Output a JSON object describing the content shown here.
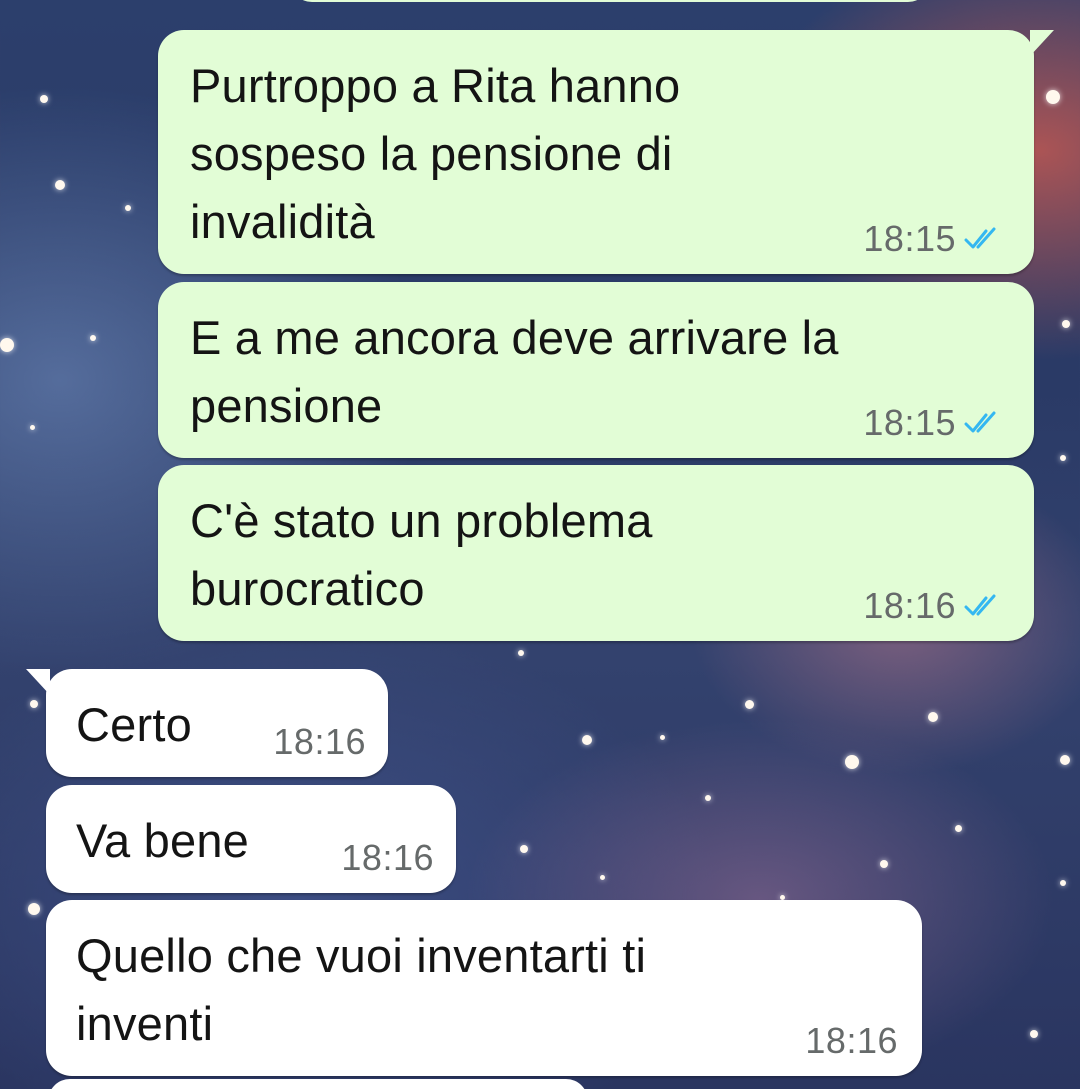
{
  "messages": [
    {
      "direction": "outgoing",
      "text": "Purtroppo a Rita hanno\nsospeso la pensione di\ninvalidità",
      "time": "18:15",
      "status": "read"
    },
    {
      "direction": "outgoing",
      "text": "E a me ancora deve arrivare la\npensione",
      "time": "18:15",
      "status": "read"
    },
    {
      "direction": "outgoing",
      "text": "C'è stato un problema\nburocratico",
      "time": "18:16",
      "status": "read"
    },
    {
      "direction": "incoming",
      "text": "Certo",
      "time": "18:16"
    },
    {
      "direction": "incoming",
      "text": "Va bene",
      "time": "18:16"
    },
    {
      "direction": "incoming",
      "text": "Quello che vuoi inventarti ti\ninventi",
      "time": "18:16"
    }
  ],
  "colors": {
    "outgoing_bubble": "#e2fdd6",
    "incoming_bubble": "#ffffff",
    "read_tick": "#34b7f1",
    "time_text": "#666a6a"
  },
  "icons": {
    "read_receipt": "double-check-icon"
  }
}
